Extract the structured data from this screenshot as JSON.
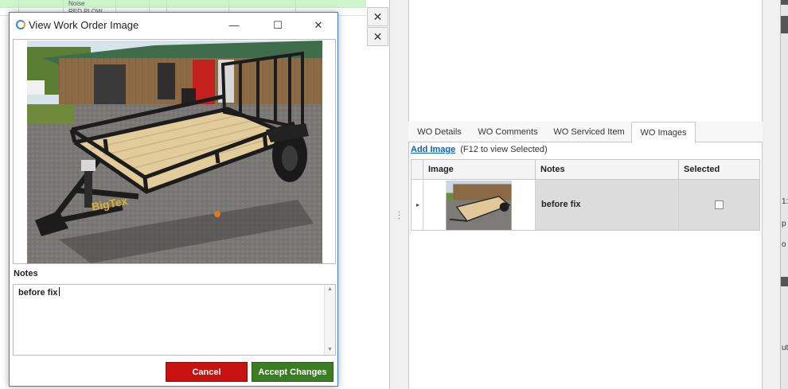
{
  "background_grid": {
    "rows": [
      {
        "cell_text": "Noise",
        "green": true
      },
      {
        "cell_text": "RED PLOW",
        "green": false
      }
    ],
    "close_glyph": "✕"
  },
  "dialog": {
    "title": "View Work Order Image",
    "window_buttons": {
      "minimize": "—",
      "maximize": "☐",
      "close": "✕"
    },
    "notes_label": "Notes",
    "notes_value": "before fix",
    "cancel_label": "Cancel",
    "accept_label": "Accept Changes"
  },
  "wo_panel": {
    "tabs": [
      {
        "label": "WO Details",
        "active": false
      },
      {
        "label": "WO Comments",
        "active": false
      },
      {
        "label": "WO Serviced Item",
        "active": false
      },
      {
        "label": "WO Images",
        "active": true
      }
    ],
    "add_image_label": "Add Image",
    "hint": "(F12 to view Selected)",
    "columns": [
      "Image",
      "Notes",
      "Selected"
    ],
    "rows": [
      {
        "notes": "before fix",
        "selected": false
      }
    ]
  },
  "edge_fragments": [
    "1:",
    "p",
    "o",
    "ut"
  ],
  "colors": {
    "cancel": "#c8120f",
    "accept": "#3b7d23",
    "link": "#0b62c4",
    "dialog_border": "#3d7fc4"
  }
}
